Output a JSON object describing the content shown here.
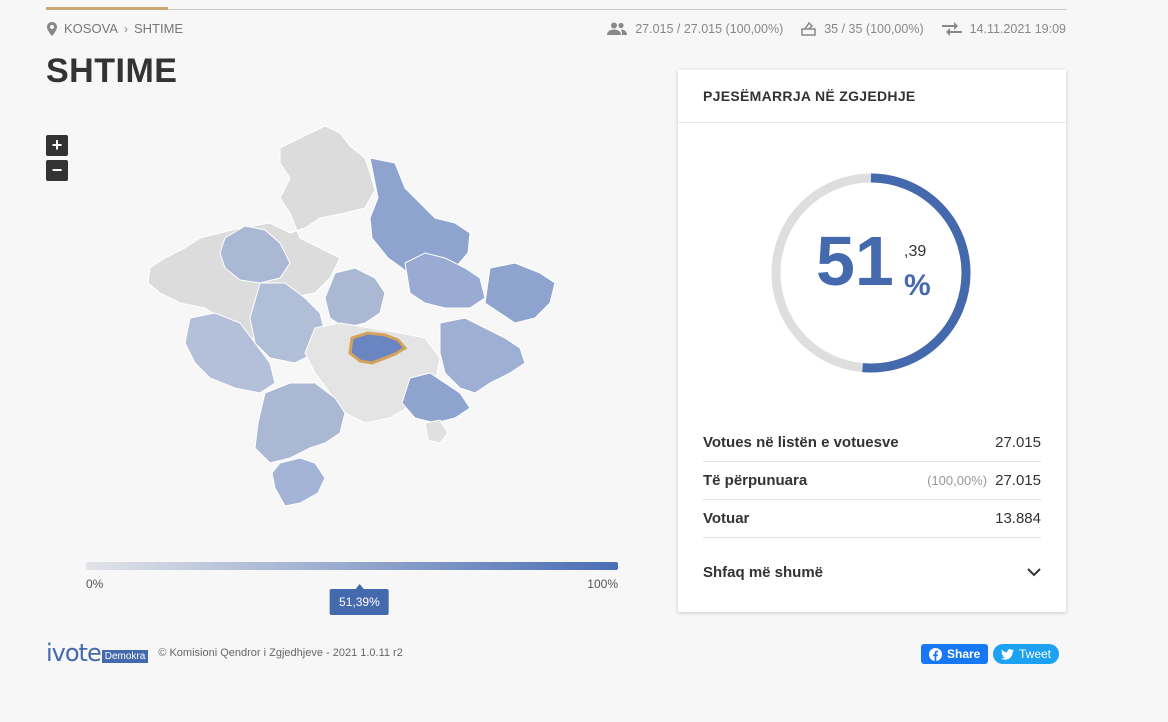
{
  "breadcrumb": {
    "root": "KOSOVA",
    "current": "SHTIME"
  },
  "stats": {
    "voters": "27.015 / 27.015 (100,00%)",
    "polling": "35 / 35 (100,00%)",
    "updated": "14.11.2021 19:09"
  },
  "page_title": "SHTIME",
  "zoom": {
    "in": "+",
    "out": "−"
  },
  "scale": {
    "min_label": "0%",
    "max_label": "100%",
    "marker_label": "51,39%",
    "marker_value": 0.5139
  },
  "turnout_card": {
    "title": "PJESËMARRJA NË ZGJEDHJE",
    "percent_int": "51",
    "percent_dec": ",39",
    "percent_sign": "%",
    "fraction": 0.5139,
    "rows": [
      {
        "label": "Votues në listën e votuesve",
        "sub": "",
        "value": "27.015"
      },
      {
        "label": "Të përpunuara",
        "sub": "(100,00%)",
        "value": "27.015"
      },
      {
        "label": "Votuar",
        "sub": "",
        "value": "13.884"
      }
    ],
    "more_label": "Shfaq më shumë"
  },
  "footer": {
    "logo_text": "ivote",
    "logo_badge": "Demokra",
    "copyright": "© Komisioni Qendror i Zgjedhjeve - 2021 1.0.11 r2"
  },
  "share": {
    "facebook": "Share",
    "twitter": "Tweet"
  },
  "colors": {
    "accent": "#4569ad",
    "scale_low": "#e1e3e7",
    "scale_high": "#4a6db4",
    "highlight_border": "#d4a25a",
    "facebook": "#1877f2",
    "twitter": "#1da1f2"
  }
}
